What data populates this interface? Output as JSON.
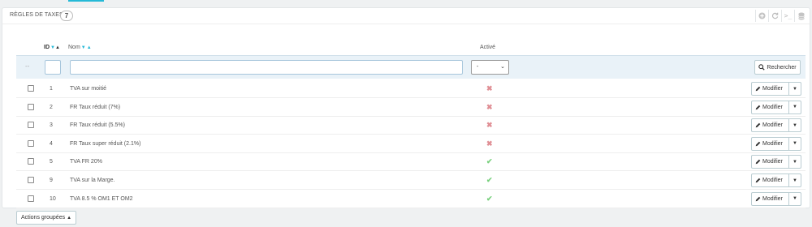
{
  "panel": {
    "title": "Règles de taxes",
    "count": "7",
    "toolbar_icons": [
      "add-icon",
      "refresh-icon",
      "sql-icon",
      "database-icon"
    ]
  },
  "columns": {
    "id": "ID",
    "name": "Nom",
    "active": "Activé"
  },
  "filter": {
    "dash": "--",
    "id_value": "",
    "name_value": "",
    "active_selected": "-",
    "search_label": "Rechercher"
  },
  "rows": [
    {
      "id": "1",
      "name": "TVA sur moitié",
      "active": false,
      "action": "Modifier"
    },
    {
      "id": "2",
      "name": "FR Taux réduit (7%)",
      "active": false,
      "action": "Modifier"
    },
    {
      "id": "3",
      "name": "FR Taux réduit (5.5%)",
      "active": false,
      "action": "Modifier"
    },
    {
      "id": "4",
      "name": "FR Taux super réduit (2.1%)",
      "active": false,
      "action": "Modifier"
    },
    {
      "id": "5",
      "name": "TVA FR 20%",
      "active": true,
      "action": "Modifier"
    },
    {
      "id": "9",
      "name": "TVA sur la Marge.",
      "active": true,
      "action": "Modifier"
    },
    {
      "id": "10",
      "name": "TVA 8.5 % OM1 ET OM2",
      "active": true,
      "action": "Modifier"
    }
  ],
  "bulk_actions": {
    "label": "Actions groupées"
  },
  "colors": {
    "accent": "#25b9d7",
    "active_yes": "#78d07d",
    "active_no": "#e08f95",
    "filter_bg": "#e9f2f8"
  }
}
